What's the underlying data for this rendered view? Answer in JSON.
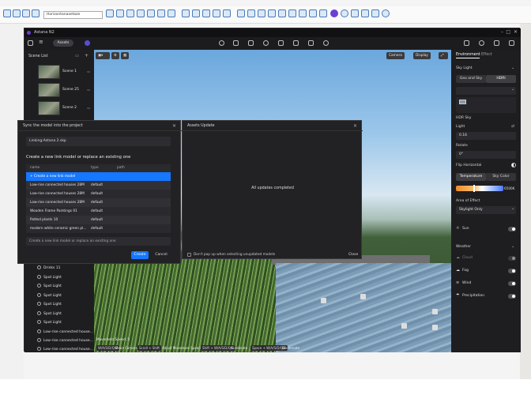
{
  "host": {
    "toolbar_select": "Horizontanaxetaze",
    "colors": {
      "toolbar_bg": "#fafafa",
      "accent": "#4a7ab8"
    }
  },
  "app": {
    "title": "Astana N2",
    "tab_assets": "Assets",
    "accent": "#1677ff"
  },
  "left_panel": {
    "header": "Scene List",
    "scenes": [
      {
        "name": "Scene 1"
      },
      {
        "name": "Scene 25"
      },
      {
        "name": "Scene 2"
      }
    ],
    "items": [
      {
        "label": "Drinks 11",
        "icon": "cube-icon"
      },
      {
        "label": "Spot Light",
        "icon": "light-icon"
      },
      {
        "label": "Spot Light",
        "icon": "light-icon"
      },
      {
        "label": "Spot Light",
        "icon": "light-icon"
      },
      {
        "label": "Spot Light",
        "icon": "light-icon"
      },
      {
        "label": "Spot Light",
        "icon": "light-icon"
      },
      {
        "label": "Spot Light",
        "icon": "light-icon"
      },
      {
        "label": "Low-rise connected house...",
        "icon": "cube-icon"
      },
      {
        "label": "Low-rise connected house...",
        "icon": "cube-icon"
      },
      {
        "label": "Low-rise connected house...",
        "icon": "cube-icon"
      }
    ]
  },
  "viewport": {
    "camera_btn": "Camera",
    "display_btn": "Display",
    "movement_speed": "Movement Speed: 5",
    "hints": [
      {
        "key": "W/A/S/D/Q/E",
        "action": "Move Camera"
      },
      {
        "key": "Scroll + Shift",
        "action": "Adjust Movement Speed"
      },
      {
        "key": "Shift + W/A/S/D/Q/E",
        "action": "Accelerate"
      },
      {
        "key": "Space + W/A/S/D/Q/E",
        "action": "Decelerate"
      }
    ]
  },
  "right_panel": {
    "tab_environment": "Environment",
    "tab_effect": "Effect",
    "sky_light": "Sky Light",
    "btn_geo": "Geo and Sky",
    "btn_hdri": "HDRI",
    "hdr_sky": "HDR Sky",
    "light": "Light",
    "light_value": "0.16",
    "rotate": "Rotate",
    "rotate_value": "0°",
    "flip": "Flip Horizontal",
    "btn_temperature": "Temperature",
    "btn_sky_color": "Sky Color",
    "temp_value": "6500K",
    "area_effect": "Area of Effect",
    "area_value": "Skylight Only",
    "sun": "Sun",
    "weather": "Weather",
    "cloud": "Cloud",
    "fog": "Fog",
    "wind": "Wind",
    "precipitation": "Precipitation"
  },
  "sync_dialog": {
    "title": "Sync the model into the project",
    "linking": "Linking:Astana 2.skp",
    "subtitle": "Create a new link model or replace an existing one",
    "col_name": "name",
    "col_type": "type",
    "col_path": "path",
    "create_row": "+ Create a new link model",
    "rows": [
      {
        "name": "Low-rise connected houses 28M",
        "type": "default"
      },
      {
        "name": "Low-rise connected houses 28M",
        "type": "default"
      },
      {
        "name": "Low-rise connected houses 28M",
        "type": "default"
      },
      {
        "name": "Wooden Frame Paintings 01",
        "type": "default"
      },
      {
        "name": "Potted plants 10",
        "type": "default"
      },
      {
        "name": "modern white ceramic green pl...",
        "type": "default"
      }
    ],
    "footer_select": "Create a new link model or replace an existing one",
    "create_btn": "Create",
    "cancel_btn": "Cancel"
  },
  "assets_dialog": {
    "title": "Assets Update",
    "message": "All updates completed",
    "checkbox": "Don't pop up when selecting unupdated models",
    "close_btn": "Close"
  }
}
